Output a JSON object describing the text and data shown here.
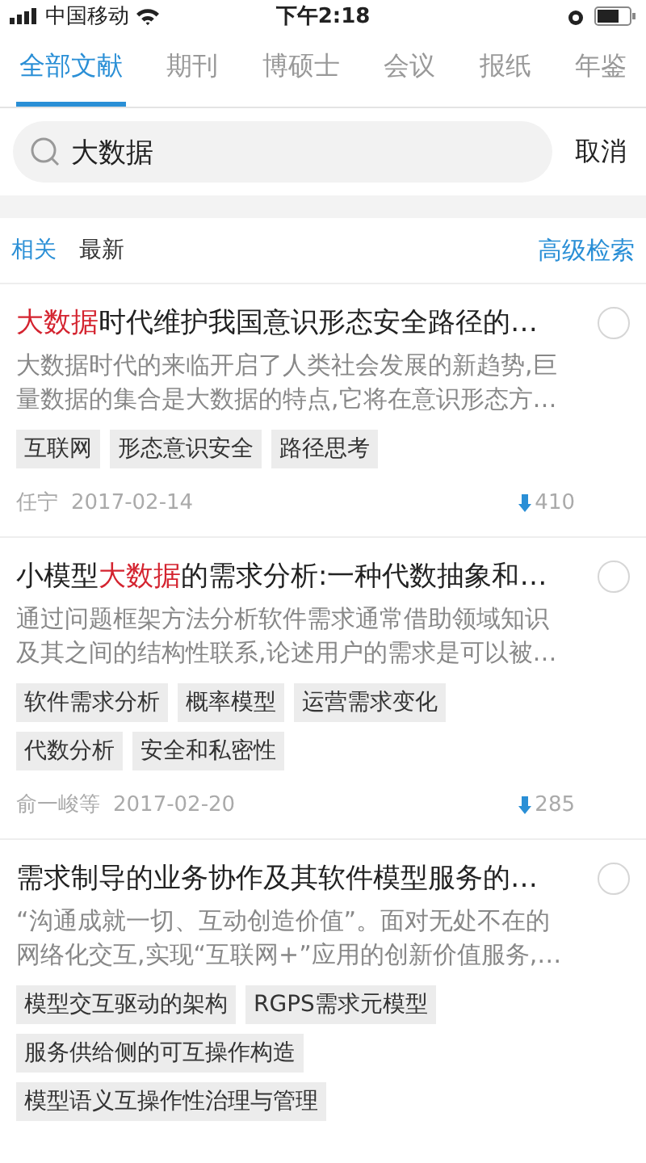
{
  "status_bar": {
    "carrier": "中国移动",
    "time": "下午2:18"
  },
  "tabs": [
    {
      "label": "全部文献",
      "selected": true
    },
    {
      "label": "期刊",
      "selected": false
    },
    {
      "label": "博硕士",
      "selected": false
    },
    {
      "label": "会议",
      "selected": false
    },
    {
      "label": "报纸",
      "selected": false
    },
    {
      "label": "年鉴",
      "selected": false
    }
  ],
  "search": {
    "value": "大数据",
    "cancel": "取消"
  },
  "sort": {
    "options": [
      {
        "label": "相关",
        "selected": true
      },
      {
        "label": "最新",
        "selected": false
      }
    ],
    "advanced": "高级检索"
  },
  "articles": [
    {
      "title": [
        {
          "text": "大数据",
          "highlight": true
        },
        {
          "text": "时代维护我国意识形态安全路径的…",
          "highlight": false
        }
      ],
      "abstract": "大数据时代的来临开启了人类社会发展的新趋势,巨量数据的集合是大数据的特点,它将在意识形态方…",
      "tags": [
        "互联网",
        "形态意识安全",
        "路径思考"
      ],
      "author": "任宁",
      "date": "2017-02-14",
      "downloads": "410",
      "selected": false
    },
    {
      "title": [
        {
          "text": "小模型",
          "highlight": false
        },
        {
          "text": "大数据",
          "highlight": true
        },
        {
          "text": "的需求分析:一种代数抽象和…",
          "highlight": false
        }
      ],
      "abstract": "通过问题框架方法分析软件需求通常借助领域知识及其之间的结构性联系,论述用户的需求是可以被…",
      "tags": [
        "软件需求分析",
        "概率模型",
        "运营需求变化",
        "代数分析",
        "安全和私密性"
      ],
      "author": "俞一峻等",
      "date": "2017-02-20",
      "downloads": "285",
      "selected": false
    },
    {
      "title": [
        {
          "text": "需求制导的业务协作及其软件模型服务的…",
          "highlight": false
        }
      ],
      "abstract": "“沟通成就一切、互动创造价值”。面对无处不在的网络化交互,实现“互联网+”应用的创新价值服务,…",
      "tags": [
        "模型交互驱动的架构",
        "RGPS需求元模型",
        "服务供给侧的可互操作构造",
        "模型语义互操作性治理与管理"
      ],
      "selected": false
    }
  ]
}
